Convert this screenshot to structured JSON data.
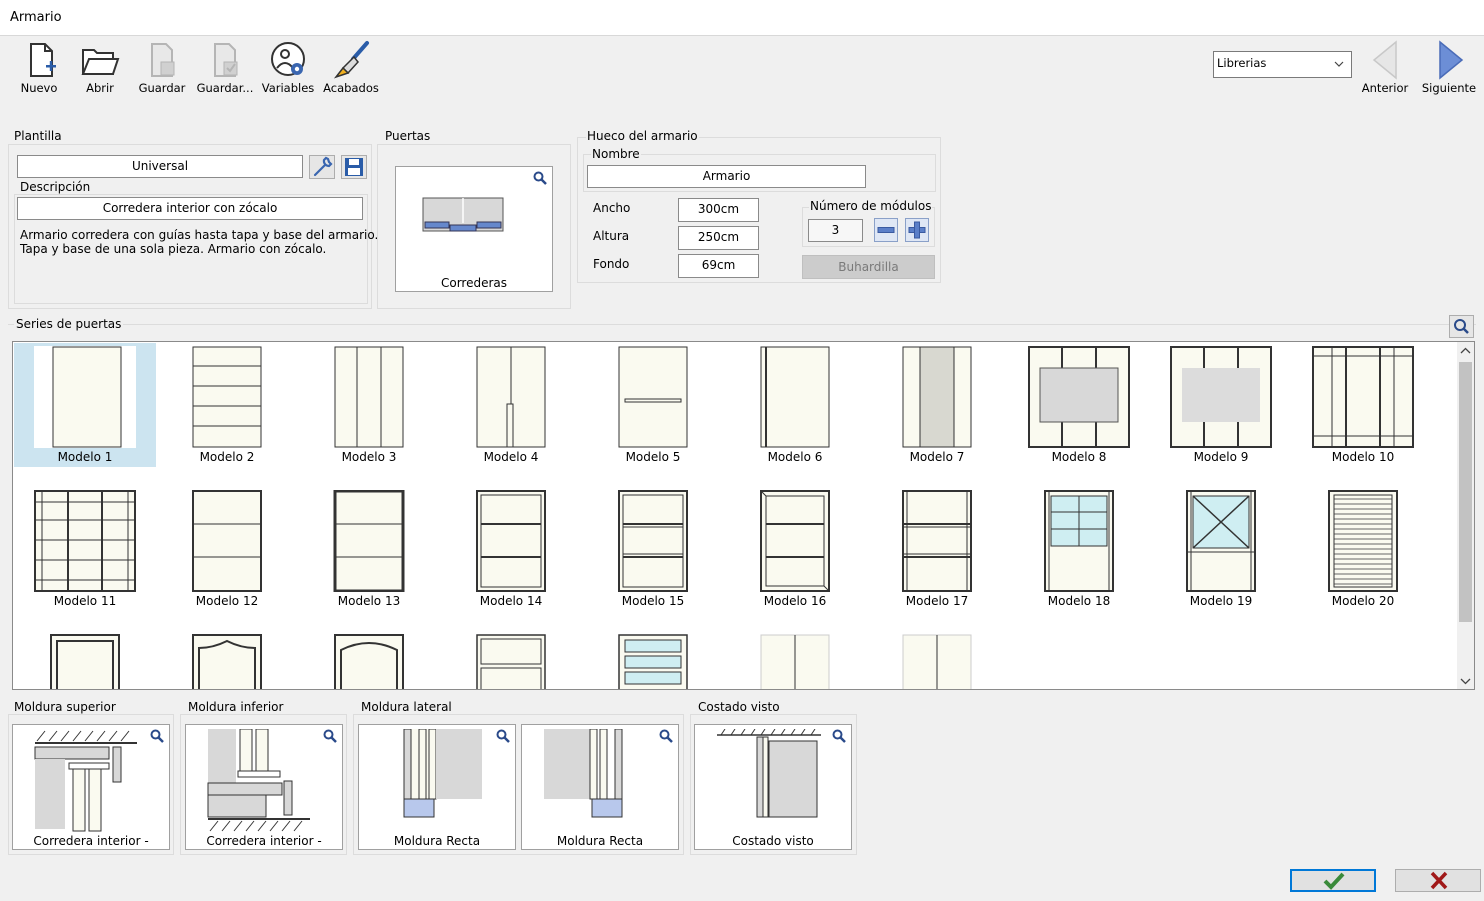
{
  "window": {
    "title": "Armario"
  },
  "toolbar": {
    "nuevo": "Nuevo",
    "abrir": "Abrir",
    "guardar": "Guardar",
    "guardar_como": "Guardar...",
    "variables": "Variables",
    "acabados": "Acabados",
    "anterior": "Anterior",
    "siguiente": "Siguiente",
    "catalog_select": "Librerias"
  },
  "plantilla": {
    "label": "Plantilla",
    "value": "Universal",
    "descripcion_label": "Descripción",
    "descripcion_value": "Corredera interior con zócalo",
    "descripcion_text": "Armario corredera con guías hasta tapa y base del armario.\nTapa y base de una sola pieza. Armario con zócalo."
  },
  "puertas": {
    "label": "Puertas",
    "caption": "Correderas"
  },
  "hueco": {
    "label": "Hueco del armario",
    "nombre_label": "Nombre",
    "nombre_value": "Armario",
    "ancho_label": "Ancho",
    "ancho_value": "300cm",
    "altura_label": "Altura",
    "altura_value": "250cm",
    "fondo_label": "Fondo",
    "fondo_value": "69cm",
    "modulos_label": "Número de módulos",
    "modulos_value": "3",
    "buhardilla_label": "Buhardilla"
  },
  "series": {
    "label": "Series de puertas",
    "selected": "Modelo 1",
    "models": [
      "Modelo 1",
      "Modelo 2",
      "Modelo 3",
      "Modelo 4",
      "Modelo 5",
      "Modelo 6",
      "Modelo 7",
      "Modelo 8",
      "Modelo 9",
      "Modelo 10",
      "Modelo 11",
      "Modelo 12",
      "Modelo 13",
      "Modelo 14",
      "Modelo 15",
      "Modelo 16",
      "Modelo 17",
      "Modelo 18",
      "Modelo 19",
      "Modelo 20"
    ]
  },
  "molduras": {
    "superior_label": "Moldura superior",
    "superior_caption": "Corredera interior -",
    "inferior_label": "Moldura inferior",
    "inferior_caption": "Corredera interior -",
    "lateral_label": "Moldura lateral",
    "lateral_caption_1": "Moldura Recta",
    "lateral_caption_2": "Moldura Recta",
    "costado_label": "Costado visto",
    "costado_caption": "Costado visto"
  },
  "colors": {
    "accent": "#0078d7",
    "door_fill": "#fafaf0",
    "door_frame": "#333333",
    "selection": "#cce4f0",
    "glass": "#cfeef2",
    "ok_check": "#3a8a3a",
    "cancel_x": "#a01818"
  },
  "icons": {
    "zoom": "magnifier-icon",
    "wrench": "wrench-icon",
    "save": "floppy-disk-icon"
  }
}
